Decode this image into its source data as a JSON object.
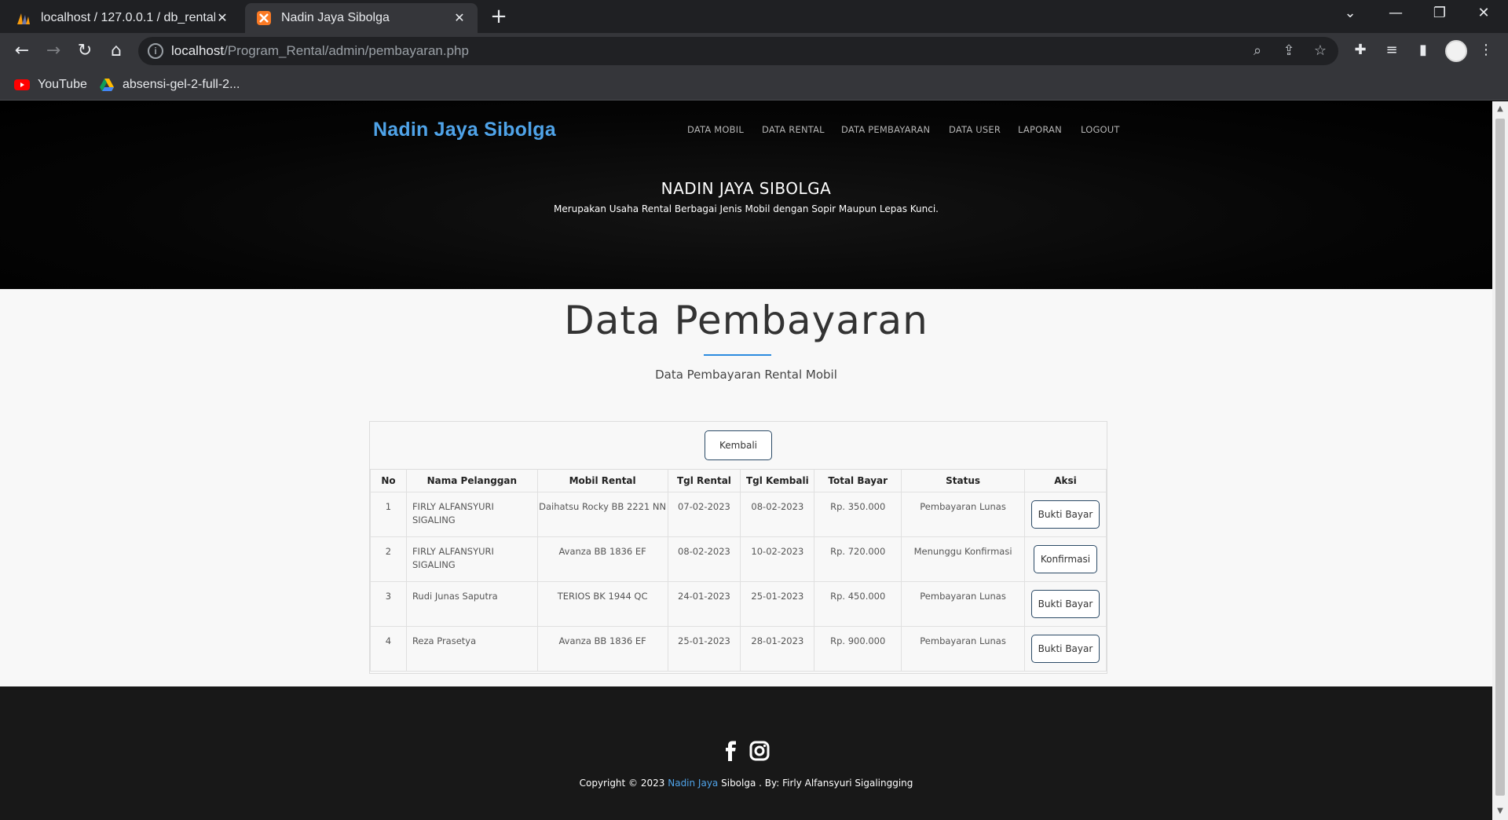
{
  "browser": {
    "tabs": [
      {
        "title": "localhost / 127.0.0.1 / db_rental / ",
        "active": false
      },
      {
        "title": "Nadin Jaya Sibolga",
        "active": true
      }
    ],
    "url_host": "localhost",
    "url_path": "/Program_Rental/admin/pembayaran.php",
    "bookmarks": [
      "YouTube",
      "absensi-gel-2-full-2..."
    ]
  },
  "site": {
    "brand": "Nadin Jaya Sibolga",
    "menu": [
      "DATA MOBIL",
      "DATA RENTAL",
      "DATA PEMBAYARAN",
      "DATA USER",
      "LAPORAN",
      "LOGOUT"
    ],
    "hero_title": "NADIN JAYA SIBOLGA",
    "hero_subtitle": "Merupakan Usaha Rental Berbagai Jenis Mobil dengan Sopir Maupun Lepas Kunci."
  },
  "section": {
    "title": "Data Pembayaran",
    "subtitle": "Data Pembayaran Rental Mobil",
    "back_button": "Kembali"
  },
  "table": {
    "headers": [
      "No",
      "Nama Pelanggan",
      "Mobil Rental",
      "Tgl Rental",
      "Tgl Kembali",
      "Total Bayar",
      "Status",
      "Aksi"
    ],
    "rows": [
      {
        "no": "1",
        "nama": "FIRLY ALFANSYURI SIGALING",
        "mobil": "Daihatsu Rocky BB 2221 NN",
        "tgl_rental": "07-02-2023",
        "tgl_kembali": "08-02-2023",
        "total": "Rp. 350.000",
        "status": "Pembayaran Lunas",
        "aksi": "Bukti Bayar"
      },
      {
        "no": "2",
        "nama": "FIRLY ALFANSYURI SIGALING",
        "mobil": "Avanza BB 1836 EF",
        "tgl_rental": "08-02-2023",
        "tgl_kembali": "10-02-2023",
        "total": "Rp. 720.000",
        "status": "Menunggu Konfirmasi",
        "aksi": "Konfirmasi"
      },
      {
        "no": "3",
        "nama": "Rudi Junas Saputra",
        "mobil": "TERIOS BK 1944 QC",
        "tgl_rental": "24-01-2023",
        "tgl_kembali": "25-01-2023",
        "total": "Rp. 450.000",
        "status": "Pembayaran Lunas",
        "aksi": "Bukti Bayar"
      },
      {
        "no": "4",
        "nama": "Reza Prasetya",
        "mobil": "Avanza BB 1836 EF",
        "tgl_rental": "25-01-2023",
        "tgl_kembali": "28-01-2023",
        "total": "Rp. 900.000",
        "status": "Pembayaran Lunas",
        "aksi": "Bukti Bayar"
      }
    ]
  },
  "footer": {
    "copyright_prefix": "Copyright © 2023 ",
    "copyright_highlight": "Nadin Jaya",
    "copyright_suffix": " Sibolga . By: Firly Alfansyuri Sigalingging"
  },
  "colors": {
    "brand": "#4fa3e8",
    "accent_line": "#2c8be0",
    "footer_bg": "#181818"
  },
  "icons": [
    "facebook-icon",
    "instagram-icon",
    "youtube-icon",
    "google-drive-icon"
  ]
}
